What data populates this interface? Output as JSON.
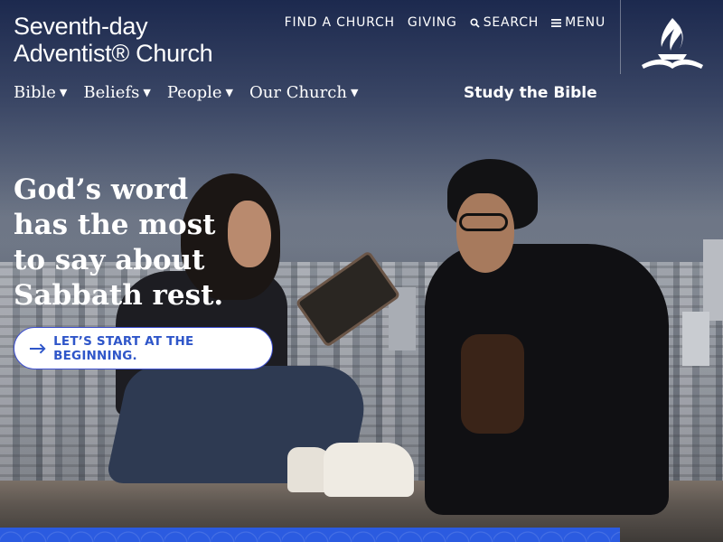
{
  "header": {
    "logo_line1": "Seventh-day",
    "logo_line2": "Adventist® Church",
    "utility": [
      {
        "label": "FIND A CHURCH"
      },
      {
        "label": "GIVING"
      },
      {
        "label": "SEARCH",
        "icon": "search-icon"
      },
      {
        "label": "MENU",
        "icon": "hamburger-icon"
      }
    ]
  },
  "main_nav": [
    {
      "label": "Bible"
    },
    {
      "label": "Beliefs"
    },
    {
      "label": "People"
    },
    {
      "label": "Our Church"
    }
  ],
  "study_link": "Study the Bible",
  "hero": {
    "headline_lines": [
      "God’s word",
      "has the most",
      "to say about",
      "Sabbath rest."
    ],
    "cta_label": "LET’S START AT THE BEGINNING."
  },
  "colors": {
    "accent_blue": "#2f56c9",
    "band_blue": "#2b5be0",
    "white": "#ffffff"
  }
}
